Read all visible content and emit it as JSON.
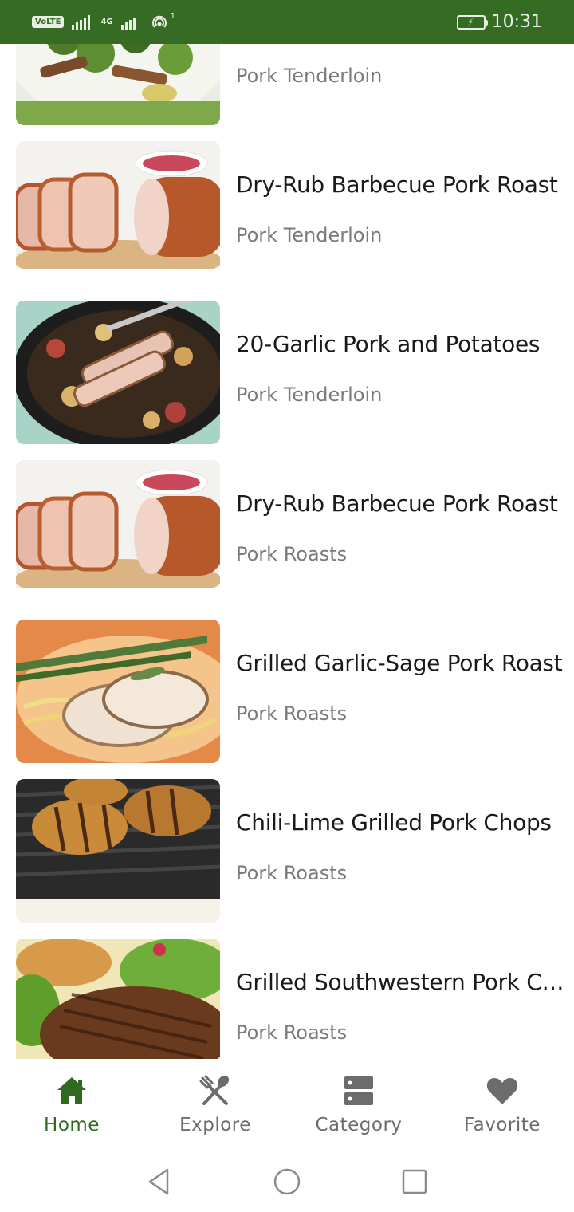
{
  "status_bar": {
    "network": "VoLTE",
    "signal_label": "4G",
    "hotspot_count": "1",
    "time": "10:31"
  },
  "recipes": [
    {
      "title": "",
      "category": "Pork Tenderloin",
      "image": "broccoli-salad"
    },
    {
      "title": "Dry-Rub Barbecue Pork Roast",
      "category": "Pork Tenderloin",
      "image": "sliced-pork-roast"
    },
    {
      "title": "20-Garlic Pork and Potatoes",
      "category": "Pork Tenderloin",
      "image": "pork-potatoes-skillet"
    },
    {
      "title": "Dry-Rub Barbecue Pork Roast",
      "category": "Pork Roasts",
      "image": "sliced-pork-roast"
    },
    {
      "title": "Grilled Garlic-Sage Pork Roast",
      "category": "Pork Roasts",
      "image": "pork-pasta-asparagus"
    },
    {
      "title": "Chili-Lime Grilled Pork Chops",
      "category": "Pork Roasts",
      "image": "pork-chops-grill"
    },
    {
      "title": "Grilled Southwestern Pork Chops",
      "category": "Pork Roasts",
      "image": "pork-chop-salad"
    }
  ],
  "bottom_nav": [
    {
      "label": "Home",
      "icon": "home-icon",
      "active": true
    },
    {
      "label": "Explore",
      "icon": "utensils-icon",
      "active": false
    },
    {
      "label": "Category",
      "icon": "category-icon",
      "active": false
    },
    {
      "label": "Favorite",
      "icon": "heart-icon",
      "active": false
    }
  ],
  "colors": {
    "brand": "#356b22",
    "active_nav": "#2f6a1f",
    "inactive_nav": "#6c6c6c"
  }
}
